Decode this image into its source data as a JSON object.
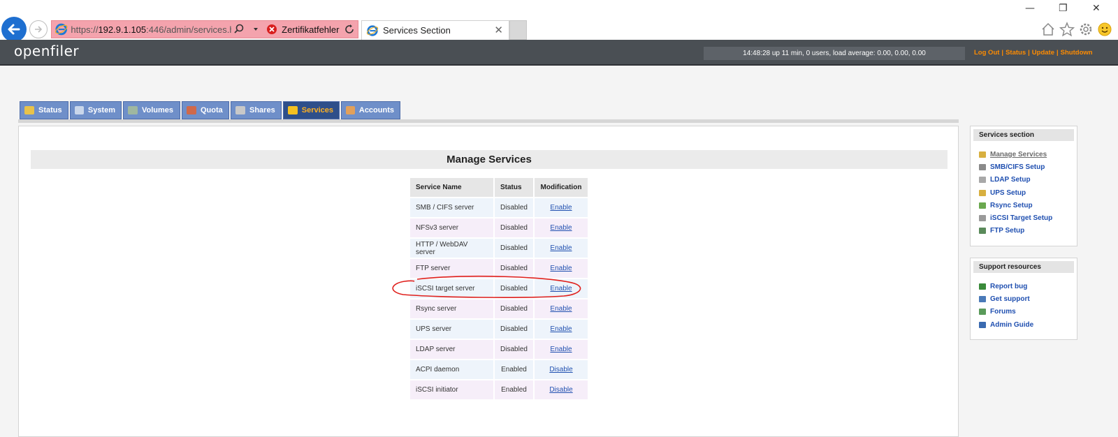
{
  "browser": {
    "url_prefix": "https://",
    "url_host": "192.9.1.105",
    "url_rest": ":446/admin/services.htm",
    "cert_error": "Zertifikatfehler",
    "tab_title": "Services Section"
  },
  "header": {
    "logo": "openfiler",
    "uptime": "14:48:28 up 11 min, 0 users, load average: 0.00, 0.00, 0.00",
    "links": [
      "Log Out",
      "Status",
      "Update",
      "Shutdown"
    ]
  },
  "nav": {
    "tabs": [
      {
        "label": "Status",
        "color": "#e8c24a"
      },
      {
        "label": "System",
        "color": "#c9d6ea"
      },
      {
        "label": "Volumes",
        "color": "#9fb7a0"
      },
      {
        "label": "Quota",
        "color": "#d0694a"
      },
      {
        "label": "Shares",
        "color": "#c8c8c8"
      },
      {
        "label": "Services",
        "color": "#f4c020"
      },
      {
        "label": "Accounts",
        "color": "#e2a05a"
      }
    ],
    "active": "Services"
  },
  "main": {
    "title": "Manage Services",
    "columns": [
      "Service Name",
      "Status",
      "Modification"
    ],
    "rows": [
      {
        "name": "SMB / CIFS server",
        "status": "Disabled",
        "action": "Enable"
      },
      {
        "name": "NFSv3 server",
        "status": "Disabled",
        "action": "Enable"
      },
      {
        "name": "HTTP / WebDAV server",
        "status": "Disabled",
        "action": "Enable"
      },
      {
        "name": "FTP server",
        "status": "Disabled",
        "action": "Enable"
      },
      {
        "name": "iSCSI target server",
        "status": "Disabled",
        "action": "Enable"
      },
      {
        "name": "Rsync server",
        "status": "Disabled",
        "action": "Enable"
      },
      {
        "name": "UPS server",
        "status": "Disabled",
        "action": "Enable"
      },
      {
        "name": "LDAP server",
        "status": "Disabled",
        "action": "Enable"
      },
      {
        "name": "ACPI daemon",
        "status": "Enabled",
        "action": "Disable"
      },
      {
        "name": "iSCSI initiator",
        "status": "Enabled",
        "action": "Disable"
      }
    ],
    "highlight_color": "#e0201c"
  },
  "sidebar": {
    "services": {
      "title": "Services section",
      "items": [
        {
          "label": "Manage Services",
          "current": true,
          "color": "#d8b040"
        },
        {
          "label": "SMB/CIFS Setup",
          "current": false,
          "color": "#8a8a8a"
        },
        {
          "label": "LDAP Setup",
          "current": false,
          "color": "#a8a8a8"
        },
        {
          "label": "UPS Setup",
          "current": false,
          "color": "#d8b040"
        },
        {
          "label": "Rsync Setup",
          "current": false,
          "color": "#6aa84f"
        },
        {
          "label": "iSCSI Target Setup",
          "current": false,
          "color": "#9a9a9a"
        },
        {
          "label": "FTP Setup",
          "current": false,
          "color": "#5a8a5a"
        }
      ]
    },
    "support": {
      "title": "Support resources",
      "items": [
        {
          "label": "Report bug",
          "color": "#3a8a3a"
        },
        {
          "label": "Get support",
          "color": "#4a7ab8"
        },
        {
          "label": "Forums",
          "color": "#5a9a5a"
        },
        {
          "label": "Admin Guide",
          "color": "#3a6ab0"
        }
      ]
    }
  }
}
